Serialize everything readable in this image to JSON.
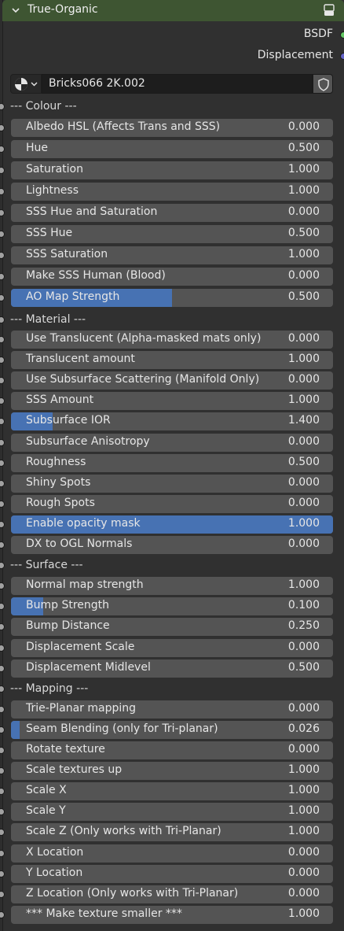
{
  "node": {
    "title": "True-Organic",
    "header_color": "#3e5532",
    "outputs": [
      {
        "label": "BSDF",
        "socket_color": "#63c763"
      },
      {
        "label": "Displacement",
        "socket_color": "#6363c7"
      }
    ],
    "material": {
      "name": "Bricks066 2K.002",
      "icons": [
        "material-sphere-icon",
        "shield-icon"
      ]
    }
  },
  "sections": {
    "colour": "--- Colour ---",
    "material": "--- Material ---",
    "surface": "--- Surface ---",
    "mapping": "--- Mapping ---"
  },
  "fields": [
    {
      "label": "Albedo HSL (Affects Trans and SSS)",
      "value": "0.000",
      "fill": 0
    },
    {
      "label": "Hue",
      "value": "0.500",
      "fill": 0
    },
    {
      "label": "Saturation",
      "value": "1.000",
      "fill": 0
    },
    {
      "label": "Lightness",
      "value": "1.000",
      "fill": 0
    },
    {
      "label": "SSS Hue and Saturation",
      "value": "0.000",
      "fill": 0
    },
    {
      "label": "SSS Hue",
      "value": "0.500",
      "fill": 0
    },
    {
      "label": "SSS Saturation",
      "value": "1.000",
      "fill": 0
    },
    {
      "label": "Make SSS Human (Blood)",
      "value": "0.000",
      "fill": 0
    },
    {
      "label": "AO Map Strength",
      "value": "0.500",
      "fill": 0.5
    },
    {
      "label": "Use Translucent (Alpha-masked mats only)",
      "value": "0.000",
      "fill": 0
    },
    {
      "label": "Translucent amount",
      "value": "1.000",
      "fill": 0
    },
    {
      "label": "Use Subsurface Scattering (Manifold Only)",
      "value": "0.000",
      "fill": 0
    },
    {
      "label": "SSS Amount",
      "value": "1.000",
      "fill": 0
    },
    {
      "label": "Subsurface IOR",
      "value": "1.400",
      "fill": 0.13
    },
    {
      "label": "Subsurface Anisotropy",
      "value": "0.000",
      "fill": 0
    },
    {
      "label": "Roughness",
      "value": "0.500",
      "fill": 0
    },
    {
      "label": "Shiny Spots",
      "value": "0.000",
      "fill": 0
    },
    {
      "label": "Rough Spots",
      "value": "0.000",
      "fill": 0
    },
    {
      "label": "Enable opacity mask",
      "value": "1.000",
      "fill": 1
    },
    {
      "label": "DX to OGL Normals",
      "value": "0.000",
      "fill": 0
    },
    {
      "label": "Normal map strength",
      "value": "1.000",
      "fill": 0
    },
    {
      "label": "Bump Strength",
      "value": "0.100",
      "fill": 0.1
    },
    {
      "label": "Bump Distance",
      "value": "0.250",
      "fill": 0
    },
    {
      "label": "Displacement Scale",
      "value": "0.000",
      "fill": 0
    },
    {
      "label": "Displacement Midlevel",
      "value": "0.500",
      "fill": 0
    },
    {
      "label": "Trie-Planar mapping",
      "value": "0.000",
      "fill": 0
    },
    {
      "label": "Seam Blending (only for Tri-planar)",
      "value": "0.026",
      "fill": 0.026
    },
    {
      "label": "Rotate texture",
      "value": "0.000",
      "fill": 0
    },
    {
      "label": "Scale textures up",
      "value": "1.000",
      "fill": 0
    },
    {
      "label": "Scale X",
      "value": "1.000",
      "fill": 0
    },
    {
      "label": "Scale Y",
      "value": "1.000",
      "fill": 0
    },
    {
      "label": "Scale Z (Only works with Tri-Planar)",
      "value": "1.000",
      "fill": 0
    },
    {
      "label": "X Location",
      "value": "0.000",
      "fill": 0
    },
    {
      "label": "Y Location",
      "value": "0.000",
      "fill": 0
    },
    {
      "label": "Z Location (Only works with Tri-Planar)",
      "value": "0.000",
      "fill": 0
    },
    {
      "label": "*** Make texture smaller ***",
      "value": "1.000",
      "fill": 0
    }
  ]
}
